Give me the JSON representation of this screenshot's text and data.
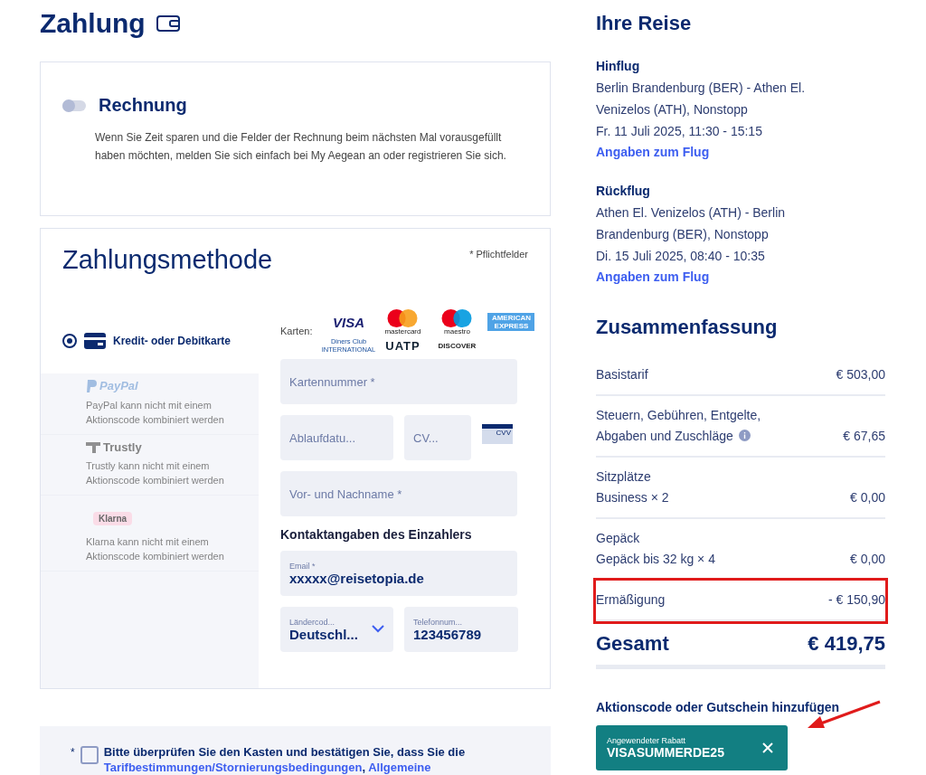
{
  "payment": {
    "title": "Zahlung"
  },
  "invoice": {
    "toggle_on": false,
    "title": "Rechnung",
    "text": "Wenn Sie Zeit sparen und die Felder der Rechnung beim nächsten Mal vorausgefüllt haben möchten, melden Sie sich einfach bei My Aegean an oder registrieren Sie sich."
  },
  "method": {
    "title": "Zahlungsmethode",
    "required_note": "* Pflichtfelder",
    "options": [
      {
        "kind": "card",
        "label": "Kredit- oder Debitkarte",
        "selected": true
      },
      {
        "kind": "paypal",
        "label": "PayPal",
        "note": "PayPal kann nicht mit einem Aktionscode kombiniert werden",
        "selected": false
      },
      {
        "kind": "trustly",
        "label": "Trustly",
        "note": "Trustly kann nicht mit einem Aktionscode kombiniert werden",
        "selected": false
      },
      {
        "kind": "klarna",
        "label": "Klarna",
        "note": "Klarna kann nicht mit einem Aktionscode kombiniert werden",
        "selected": false
      }
    ],
    "cards_label": "Karten:",
    "card_logos": [
      {
        "kind": "visa",
        "label": "VISA"
      },
      {
        "kind": "mastercard",
        "label": "mastercard"
      },
      {
        "kind": "maestro",
        "label": "maestro"
      },
      {
        "kind": "amex",
        "label": "AMERICAN EXPRESS"
      },
      {
        "kind": "diners",
        "label": "Diners Club INTERNATIONAL"
      },
      {
        "kind": "uatp",
        "label": "UATP"
      },
      {
        "kind": "discover",
        "label": "DISCOVER"
      }
    ],
    "card_number": {
      "placeholder": "Kartennummer *"
    },
    "expiry": {
      "placeholder": "Ablaufdatu..."
    },
    "cvv": {
      "placeholder": "CV...",
      "icon_label": "CVV"
    },
    "name": {
      "placeholder": "Vor- und Nachname *"
    },
    "contact_title": "Kontaktangaben des Einzahlers",
    "email": {
      "label": "Email *",
      "value": "xxxxx@reisetopia.de"
    },
    "country": {
      "label": "Ländercod...",
      "value": "Deutschl..."
    },
    "phone": {
      "label": "Telefonnum...",
      "value": "123456789"
    }
  },
  "consent": {
    "asterisk": "*",
    "checked": false,
    "text": "Bitte überprüfen Sie den Kasten und bestätigen Sie, dass Sie die",
    "links": [
      "Tarifbestimmungen/Stornierungsbedingungen",
      "Allgemeine"
    ],
    "separator": ","
  },
  "trip": {
    "title": "Ihre Reise",
    "flights": [
      {
        "title": "Hinflug",
        "route": "Berlin Brandenburg (BER) - Athen El. Venizelos (ATH), Nonstopp",
        "date": "Fr. 11 Juli 2025, 11:30 - 15:15",
        "link": "Angaben zum Flug"
      },
      {
        "title": "Rückflug",
        "route": "Athen El. Venizelos (ATH) - Berlin Brandenburg (BER), Nonstopp",
        "date": "Di. 15 Juli 2025, 08:40 - 10:35",
        "link": "Angaben zum Flug"
      }
    ]
  },
  "summary": {
    "title": "Zusammenfassung",
    "rows": [
      {
        "label": "Basistarif",
        "amount": "€ 503,00",
        "highlighted": false
      },
      {
        "label": "Steuern, Gebühren, Entgelte, Abgaben und Zuschläge",
        "info": true,
        "amount": "€ 67,65",
        "highlighted": false
      },
      {
        "label": "Sitzplätze",
        "detail": "Business × 2",
        "amount": "€ 0,00",
        "highlighted": false
      },
      {
        "label": "Gepäck",
        "detail": "Gepäck bis 32 kg × 4",
        "amount": "€ 0,00",
        "highlighted": false
      },
      {
        "label": "Ermäßigung",
        "amount": "- € 150,90",
        "highlighted": true
      }
    ],
    "total_label": "Gesamt",
    "total": "€ 419,75"
  },
  "promo": {
    "title": "Aktionscode oder Gutschein hinzufügen",
    "chip_label": "Angewendeter Rabatt",
    "code": "VISASUMMERDE25",
    "arrow": true
  }
}
